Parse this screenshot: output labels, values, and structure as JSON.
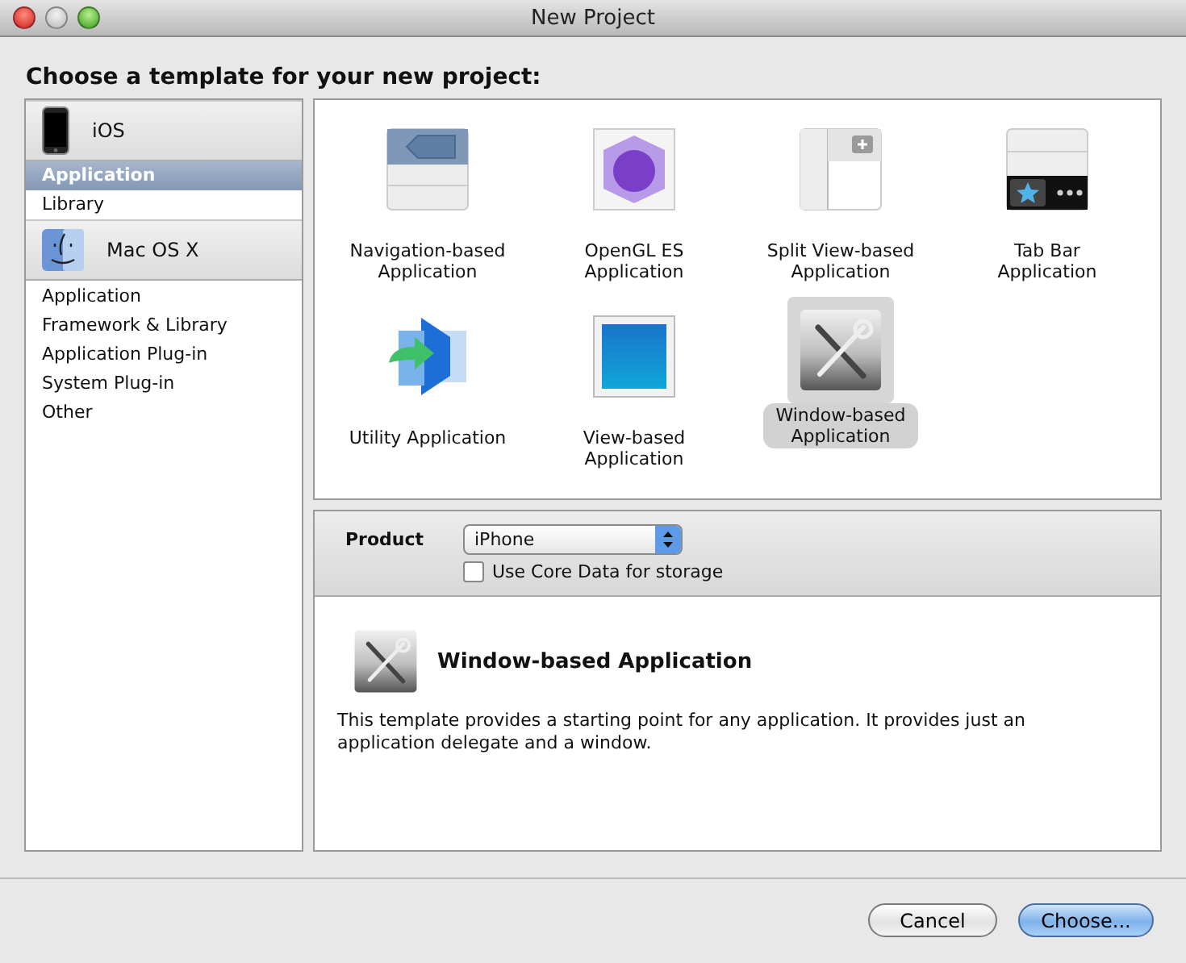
{
  "window": {
    "title": "New Project"
  },
  "heading": "Choose a template for your new project:",
  "sidebar": {
    "sections": [
      {
        "title": "iOS",
        "kind": "phone",
        "items": [
          {
            "label": "Application",
            "selected": true
          },
          {
            "label": "Library",
            "selected": false
          }
        ]
      },
      {
        "title": "Mac OS X",
        "kind": "finder",
        "items": [
          {
            "label": "Application",
            "selected": false
          },
          {
            "label": "Framework & Library",
            "selected": false
          },
          {
            "label": "Application Plug-in",
            "selected": false
          },
          {
            "label": "System Plug-in",
            "selected": false
          },
          {
            "label": "Other",
            "selected": false
          }
        ]
      }
    ]
  },
  "templates": [
    {
      "label": "Navigation-based\nApplication",
      "kind": "navigation",
      "selected": false
    },
    {
      "label": "OpenGL ES\nApplication",
      "kind": "opengl",
      "selected": false
    },
    {
      "label": "Split View-based\nApplication",
      "kind": "split",
      "selected": false
    },
    {
      "label": "Tab Bar\nApplication",
      "kind": "tabbar",
      "selected": false
    },
    {
      "label": "Utility Application",
      "kind": "utility",
      "selected": false
    },
    {
      "label": "View-based\nApplication",
      "kind": "view",
      "selected": false
    },
    {
      "label": "Window-based\nApplication",
      "kind": "window",
      "selected": true
    }
  ],
  "options": {
    "product_label": "Product",
    "product_value": "iPhone",
    "core_data": {
      "label": "Use Core Data for storage",
      "checked": false
    }
  },
  "detail": {
    "title": "Window-based Application",
    "kind": "window",
    "description": "This template provides a starting point for any application. It provides just an application delegate and a window."
  },
  "buttons": [
    {
      "label": "Cancel",
      "primary": false
    },
    {
      "label": "Choose...",
      "primary": true
    }
  ]
}
